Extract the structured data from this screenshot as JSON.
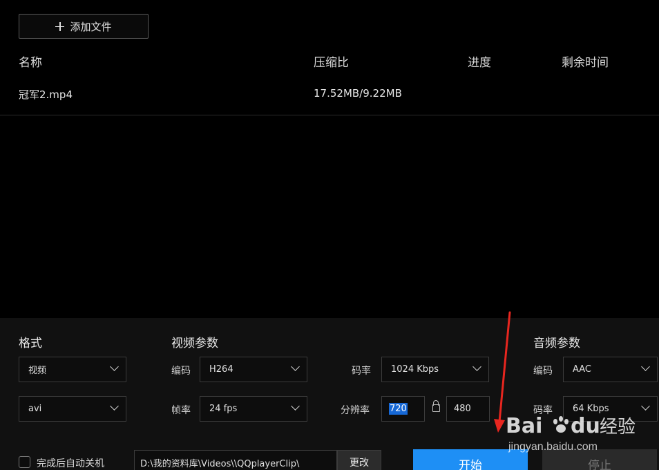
{
  "toolbar": {
    "add_file_label": "添加文件"
  },
  "file_table": {
    "columns": [
      "名称",
      "压缩比",
      "进度",
      "剩余时间"
    ],
    "rows": [
      {
        "name": "冠军2.mp4",
        "ratio": "17.52MB/9.22MB",
        "progress": "",
        "remaining": ""
      }
    ]
  },
  "settings": {
    "format": {
      "title": "格式",
      "type_value": "视频",
      "container_value": "avi"
    },
    "video": {
      "title": "视频参数",
      "codec_label": "编码",
      "codec_value": "H264",
      "bitrate_label": "码率",
      "bitrate_value": "1024 Kbps",
      "framerate_label": "帧率",
      "framerate_value": "24 fps",
      "resolution_label": "分辨率",
      "width_value": "720",
      "height_value": "480"
    },
    "audio": {
      "title": "音频参数",
      "codec_label": "编码",
      "codec_value": "AAC",
      "bitrate_label": "码率",
      "bitrate_value": "64 Kbps"
    }
  },
  "footer": {
    "shutdown_label": "完成后自动关机",
    "output_path": "D:\\我的资料库\\Videos\\\\QQplayerClip\\",
    "change_label": "更改",
    "start_label": "开始",
    "stop_label": "停止"
  },
  "watermark": {
    "text": "jingyan.baidu.com"
  },
  "colors": {
    "accent": "#1e8ff5",
    "annotation_arrow": "#e8261f"
  }
}
